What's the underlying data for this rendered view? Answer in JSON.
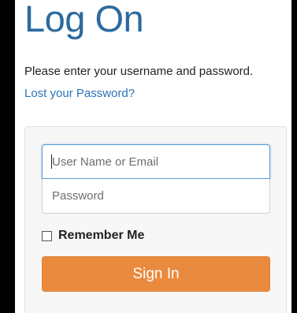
{
  "page": {
    "title": "Log On",
    "instructions": "Please enter your username and password.",
    "lost_password_link": "Lost your Password?"
  },
  "form": {
    "username": {
      "value": "",
      "placeholder": "User Name or Email"
    },
    "password": {
      "value": "",
      "placeholder": "Password"
    },
    "remember_me": {
      "label": "Remember Me",
      "checked": false
    },
    "submit_label": "Sign In"
  },
  "colors": {
    "title": "#2c6a9e",
    "link": "#2a74b8",
    "button": "#ea8a3f",
    "focus_border": "#5b9bd5",
    "panel_background": "#f7f7f7"
  }
}
